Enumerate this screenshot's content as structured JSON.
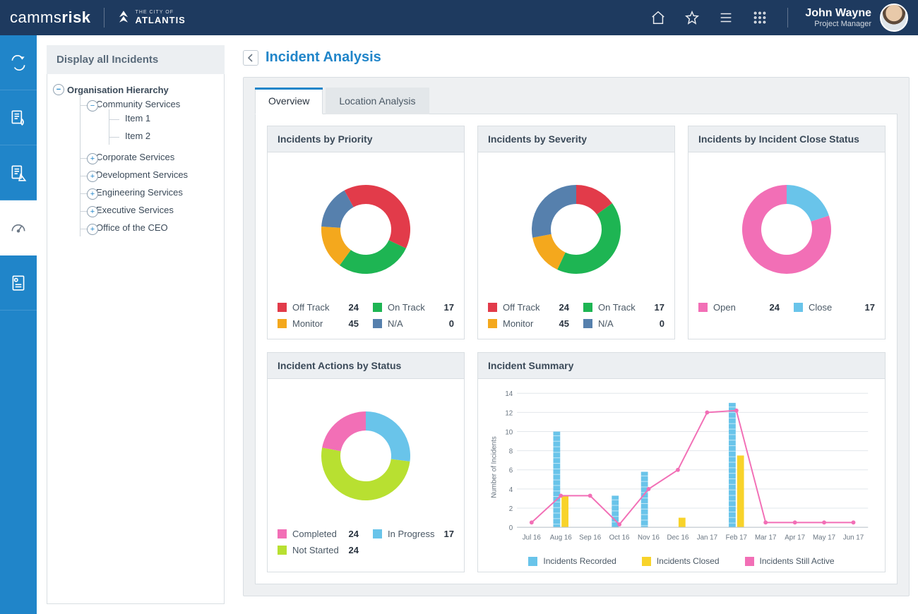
{
  "brand": {
    "product_prefix": "camms",
    "product_suffix": "risk",
    "client_small": "THE CITY OF",
    "client_big": "ATLANTIS"
  },
  "user": {
    "name": "John Wayne",
    "role": "Project Manager"
  },
  "sidepanel": {
    "title": "Display all Incidents",
    "root": "Organisation Hierarchy",
    "nodes": [
      {
        "label": "Community Services",
        "expanded": true,
        "children": [
          "Item 1",
          "Item 2"
        ]
      },
      {
        "label": "Corporate Services",
        "expanded": false
      },
      {
        "label": "Development Services",
        "expanded": false
      },
      {
        "label": "Engineering Services",
        "expanded": false
      },
      {
        "label": "Executive Services",
        "expanded": false
      },
      {
        "label": "Office of the CEO",
        "expanded": false
      }
    ]
  },
  "page": {
    "title": "Incident Analysis"
  },
  "tabs": [
    "Overview",
    "Location Analysis"
  ],
  "active_tab": 0,
  "colors": {
    "off_track": "#e23b4a",
    "on_track": "#1eb553",
    "monitor": "#f4a81d",
    "na": "#5680ad",
    "open": "#f26fb6",
    "close": "#69c4ea",
    "completed": "#f26fb6",
    "in_progress": "#69c4ea",
    "not_started": "#b8e031",
    "bar_recorded": "#69c4ea",
    "bar_closed": "#f8d32a",
    "line_active": "#f26fb6"
  },
  "cards": {
    "priority": {
      "title": "Incidents by Priority",
      "series": [
        {
          "key": "off_track",
          "label": "Off Track",
          "value": 24
        },
        {
          "key": "on_track",
          "label": "On Track",
          "value": 17
        },
        {
          "key": "monitor",
          "label": "Monitor",
          "value": 45
        },
        {
          "key": "na",
          "label": "N/A",
          "value": 0
        }
      ]
    },
    "severity": {
      "title": "Incidents by Severity",
      "series": [
        {
          "key": "off_track",
          "label": "Off Track",
          "value": 24
        },
        {
          "key": "on_track",
          "label": "On Track",
          "value": 17
        },
        {
          "key": "monitor",
          "label": "Monitor",
          "value": 45
        },
        {
          "key": "na",
          "label": "N/A",
          "value": 0
        }
      ]
    },
    "close_status": {
      "title": "Incidents by Incident Close Status",
      "series": [
        {
          "key": "open",
          "label": "Open",
          "value": 24
        },
        {
          "key": "close",
          "label": "Close",
          "value": 17
        }
      ]
    },
    "actions": {
      "title": "Incident Actions by Status",
      "series": [
        {
          "key": "completed",
          "label": "Completed",
          "value": 24
        },
        {
          "key": "in_progress",
          "label": "In Progress",
          "value": 17
        },
        {
          "key": "not_started",
          "label": "Not Started",
          "value": 24
        }
      ]
    },
    "summary": {
      "title": "Incident Summary",
      "ylabel": "Number of Incidents",
      "y_ticks": [
        0,
        2,
        4,
        6,
        8,
        10,
        12,
        14
      ],
      "categories": [
        "Jul 16",
        "Aug 16",
        "Sep 16",
        "Oct 16",
        "Nov 16",
        "Dec 16",
        "Jan 17",
        "Feb 17",
        "Mar 17",
        "Apr 17",
        "May 17",
        "Jun 17"
      ],
      "recorded": [
        0,
        10,
        0,
        3.3,
        5.8,
        0,
        0,
        13,
        0,
        0,
        0,
        0
      ],
      "closed": [
        0,
        3.3,
        0,
        0,
        0,
        1,
        0,
        7.5,
        0,
        0,
        0,
        0
      ],
      "active": [
        0.5,
        3.3,
        3.3,
        0.3,
        4,
        6,
        12,
        12.2,
        0.5,
        0.5,
        0.5,
        0.5
      ],
      "legend": [
        "Incidents  Recorded",
        "Incidents Closed",
        "Incidents Still Active"
      ]
    }
  },
  "chart_data": [
    {
      "type": "pie",
      "title": "Incidents by Priority",
      "series": [
        {
          "name": "Off Track",
          "value": 24
        },
        {
          "name": "On Track",
          "value": 17
        },
        {
          "name": "Monitor",
          "value": 45
        },
        {
          "name": "N/A",
          "value": 0
        }
      ],
      "donut_by_visual": [
        {
          "name": "Off Track",
          "value": 30
        },
        {
          "name": "On Track",
          "value": 25
        },
        {
          "name": "Monitor",
          "value": 15
        },
        {
          "name": "N/A",
          "value": 15
        }
      ]
    },
    {
      "type": "pie",
      "title": "Incidents by Severity",
      "series": [
        {
          "name": "Off Track",
          "value": 24
        },
        {
          "name": "On Track",
          "value": 17
        },
        {
          "name": "Monitor",
          "value": 45
        },
        {
          "name": "N/A",
          "value": 0
        }
      ],
      "donut_by_visual": [
        {
          "name": "On Track",
          "value": 40
        },
        {
          "name": "Off Track",
          "value": 15
        },
        {
          "name": "N/A",
          "value": 25
        },
        {
          "name": "Monitor",
          "value": 15
        }
      ]
    },
    {
      "type": "pie",
      "title": "Incidents by Incident Close Status",
      "series": [
        {
          "name": "Open",
          "value": 24
        },
        {
          "name": "Close",
          "value": 17
        }
      ],
      "donut_by_visual": [
        {
          "name": "Open",
          "value": 80
        },
        {
          "name": "Close",
          "value": 20
        }
      ]
    },
    {
      "type": "pie",
      "title": "Incident Actions by Status",
      "series": [
        {
          "name": "Completed",
          "value": 24
        },
        {
          "name": "In Progress",
          "value": 17
        },
        {
          "name": "Not Started",
          "value": 24
        }
      ],
      "donut_by_visual": [
        {
          "name": "Not Started",
          "value": 50
        },
        {
          "name": "Completed",
          "value": 20
        },
        {
          "name": "In Progress",
          "value": 25
        }
      ]
    },
    {
      "type": "bar",
      "title": "Incident Summary",
      "xlabel": "",
      "ylabel": "Number of Incidents",
      "ylim": [
        0,
        14
      ],
      "categories": [
        "Jul 16",
        "Aug 16",
        "Sep 16",
        "Oct 16",
        "Nov 16",
        "Dec 16",
        "Jan 17",
        "Feb 17",
        "Mar 17",
        "Apr 17",
        "May 17",
        "Jun 17"
      ],
      "series": [
        {
          "name": "Incidents Recorded",
          "type": "bar",
          "values": [
            0,
            10,
            0,
            3.3,
            5.8,
            0,
            0,
            13,
            0,
            0,
            0,
            0
          ]
        },
        {
          "name": "Incidents Closed",
          "type": "bar",
          "values": [
            0,
            3.3,
            0,
            0,
            0,
            1,
            0,
            7.5,
            0,
            0,
            0,
            0
          ]
        },
        {
          "name": "Incidents Still Active",
          "type": "line",
          "values": [
            0.5,
            3.3,
            3.3,
            0.3,
            4,
            6,
            12,
            12.2,
            0.5,
            0.5,
            0.5,
            0.5
          ]
        }
      ]
    }
  ]
}
